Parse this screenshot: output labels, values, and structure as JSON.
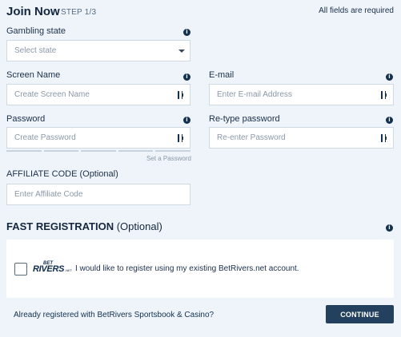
{
  "header": {
    "title": "Join Now",
    "step": "STEP 1/3",
    "required_note": "All fields are required"
  },
  "form": {
    "gambling_state": {
      "label": "Gambling state",
      "placeholder": "Select state"
    },
    "screen_name": {
      "label": "Screen Name",
      "placeholder": "Create Screen Name"
    },
    "email": {
      "label": "E-mail",
      "placeholder": "Enter E-mail Address"
    },
    "password": {
      "label": "Password",
      "placeholder": "Create Password",
      "strength_label": "Set a Password"
    },
    "retype_password": {
      "label": "Re-type password",
      "placeholder": "Re-enter Password"
    },
    "affiliate_code": {
      "label": "AFFILIATE CODE (Optional)",
      "placeholder": "Enter Affiliate Code"
    }
  },
  "fast_registration": {
    "title_bold": "FAST REGISTRATION",
    "title_light": " (Optional)",
    "logo_top": "BET",
    "logo_main": "RIVERS",
    "logo_suffix": ".NET",
    "checkbox_label": "I would like to register using my existing BetRivers.net account."
  },
  "footer": {
    "already_registered": "Already registered with BetRivers Sportsbook & Casino?",
    "continue_label": "CONTINUE"
  },
  "icons": {
    "info": "info-icon",
    "password_manager": "password-manager-icon",
    "dropdown": "chevron-down-icon"
  },
  "colors": {
    "background": "#eef4f9",
    "primary_button": "#23415f",
    "info_icon": "#12304f"
  }
}
